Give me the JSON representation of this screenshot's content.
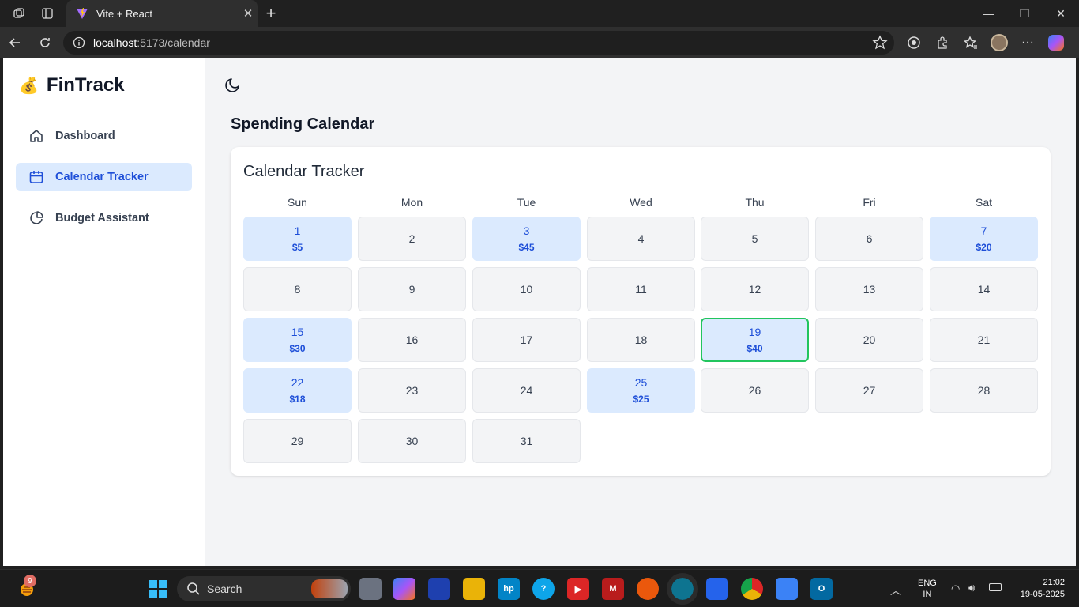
{
  "browser": {
    "tab_title": "Vite + React",
    "url_host": "localhost",
    "url_path": ":5173/calendar"
  },
  "app": {
    "brand_icon": "💰",
    "brand": "FinTrack",
    "nav": [
      {
        "label": "Dashboard",
        "icon": "home-icon"
      },
      {
        "label": "Calendar Tracker",
        "icon": "calendar-icon",
        "active": true
      },
      {
        "label": "Budget Assistant",
        "icon": "pie-chart-icon"
      }
    ]
  },
  "page": {
    "title": "Spending Calendar",
    "card_title": "Calendar Tracker",
    "weekdays": [
      "Sun",
      "Mon",
      "Tue",
      "Wed",
      "Thu",
      "Fri",
      "Sat"
    ],
    "days": [
      {
        "day": "1",
        "amount": "$5"
      },
      {
        "day": "2"
      },
      {
        "day": "3",
        "amount": "$45"
      },
      {
        "day": "4"
      },
      {
        "day": "5"
      },
      {
        "day": "6"
      },
      {
        "day": "7",
        "amount": "$20"
      },
      {
        "day": "8"
      },
      {
        "day": "9"
      },
      {
        "day": "10"
      },
      {
        "day": "11"
      },
      {
        "day": "12"
      },
      {
        "day": "13"
      },
      {
        "day": "14"
      },
      {
        "day": "15",
        "amount": "$30"
      },
      {
        "day": "16"
      },
      {
        "day": "17"
      },
      {
        "day": "18"
      },
      {
        "day": "19",
        "amount": "$40",
        "today": true
      },
      {
        "day": "20"
      },
      {
        "day": "21"
      },
      {
        "day": "22",
        "amount": "$18"
      },
      {
        "day": "23"
      },
      {
        "day": "24"
      },
      {
        "day": "25",
        "amount": "$25"
      },
      {
        "day": "26"
      },
      {
        "day": "27"
      },
      {
        "day": "28"
      },
      {
        "day": "29"
      },
      {
        "day": "30"
      },
      {
        "day": "31"
      }
    ]
  },
  "taskbar": {
    "widget_badge": "9",
    "search_placeholder": "Search",
    "lang": "ENG",
    "region": "IN",
    "time": "21:02",
    "date": "19-05-2025"
  },
  "colors": {
    "accent": "#1d4ed8",
    "spent_bg": "#dbeafe",
    "today_border": "#22c55e"
  }
}
